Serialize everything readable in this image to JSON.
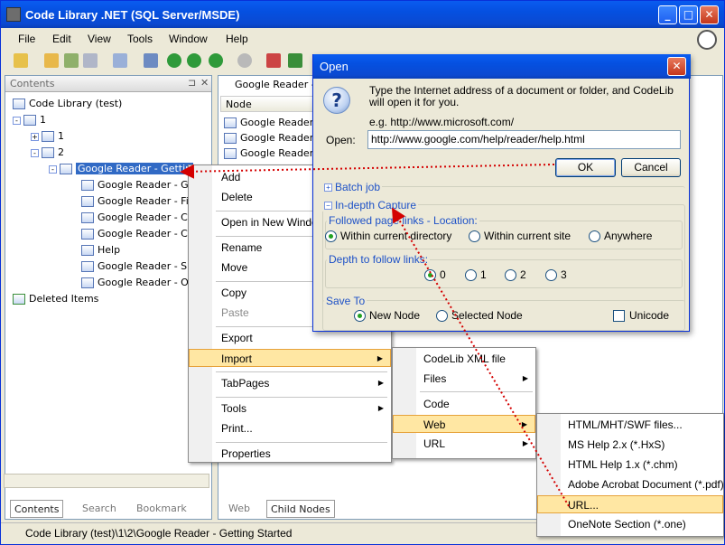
{
  "app": {
    "title": "Code Library .NET (SQL Server/MSDE)"
  },
  "menubar": [
    "File",
    "Edit",
    "View",
    "Tools",
    "Window",
    "Help"
  ],
  "contents": {
    "title": "Contents",
    "tree": [
      {
        "label": "Code Library (test)"
      },
      {
        "label": "1"
      },
      {
        "label": "1"
      },
      {
        "label": "2"
      },
      {
        "label": "Google Reader - Gettin",
        "selected": true
      },
      {
        "label": "Google Reader - Ge"
      },
      {
        "label": "Google Reader - Fir"
      },
      {
        "label": "Google Reader - Co"
      },
      {
        "label": "Google Reader - Co"
      },
      {
        "label": "Help"
      },
      {
        "label": "Google Reader - Sh"
      },
      {
        "label": "Google Reader - Of"
      },
      {
        "label": "Deleted Items"
      }
    ],
    "tabs": [
      "Contents",
      "Search",
      "Bookmark"
    ]
  },
  "rightpane": {
    "tab": "Google Reader -",
    "column": "Node",
    "rows": [
      "Google Reader -",
      "Google Reader -",
      "Google Reader -"
    ],
    "tabs": [
      "Web",
      "Child Nodes"
    ]
  },
  "status": "Code Library (test)\\1\\2\\Google Reader - Getting Started",
  "context_menu": {
    "items": [
      "Add",
      "Delete",
      "Open in New Windo",
      "Rename",
      "Move",
      "Copy",
      "Paste",
      "Export",
      "Import",
      "TabPages",
      "Tools",
      "Print...",
      "Properties"
    ]
  },
  "import_menu": {
    "items": [
      "CodeLib XML file",
      "Files",
      "Code",
      "Web",
      "URL"
    ]
  },
  "web_menu": {
    "items": [
      "HTML/MHT/SWF files...",
      "MS Help 2.x (*.HxS)",
      "HTML Help 1.x (*.chm)",
      "Adobe Acrobat Document (*.pdf)",
      "URL...",
      "OneNote Section (*.one)"
    ]
  },
  "open_dialog": {
    "title": "Open",
    "message": "Type the Internet address of a document or folder, and CodeLib will open it for you.",
    "example": "e.g. http://www.microsoft.com/",
    "open_label": "Open:",
    "url": "http://www.google.com/help/reader/help.html",
    "ok": "OK",
    "cancel": "Cancel",
    "batch_job": "Batch job",
    "indepth": "In-depth Capture",
    "followed_label": "Followed page links - Location:",
    "location_options": [
      "Within current directory",
      "Within current site",
      "Anywhere"
    ],
    "depth_label": "Depth to follow links:",
    "depth_options": [
      "0",
      "1",
      "2",
      "3"
    ],
    "save_to_label": "Save To",
    "save_options": [
      "New Node",
      "Selected Node"
    ],
    "unicode": "Unicode"
  },
  "colors": {
    "title_blue": "#0a5cf0",
    "highlight": "#ffe7a3",
    "selection": "#316ac5",
    "annotation_arrow": "#d40000"
  }
}
